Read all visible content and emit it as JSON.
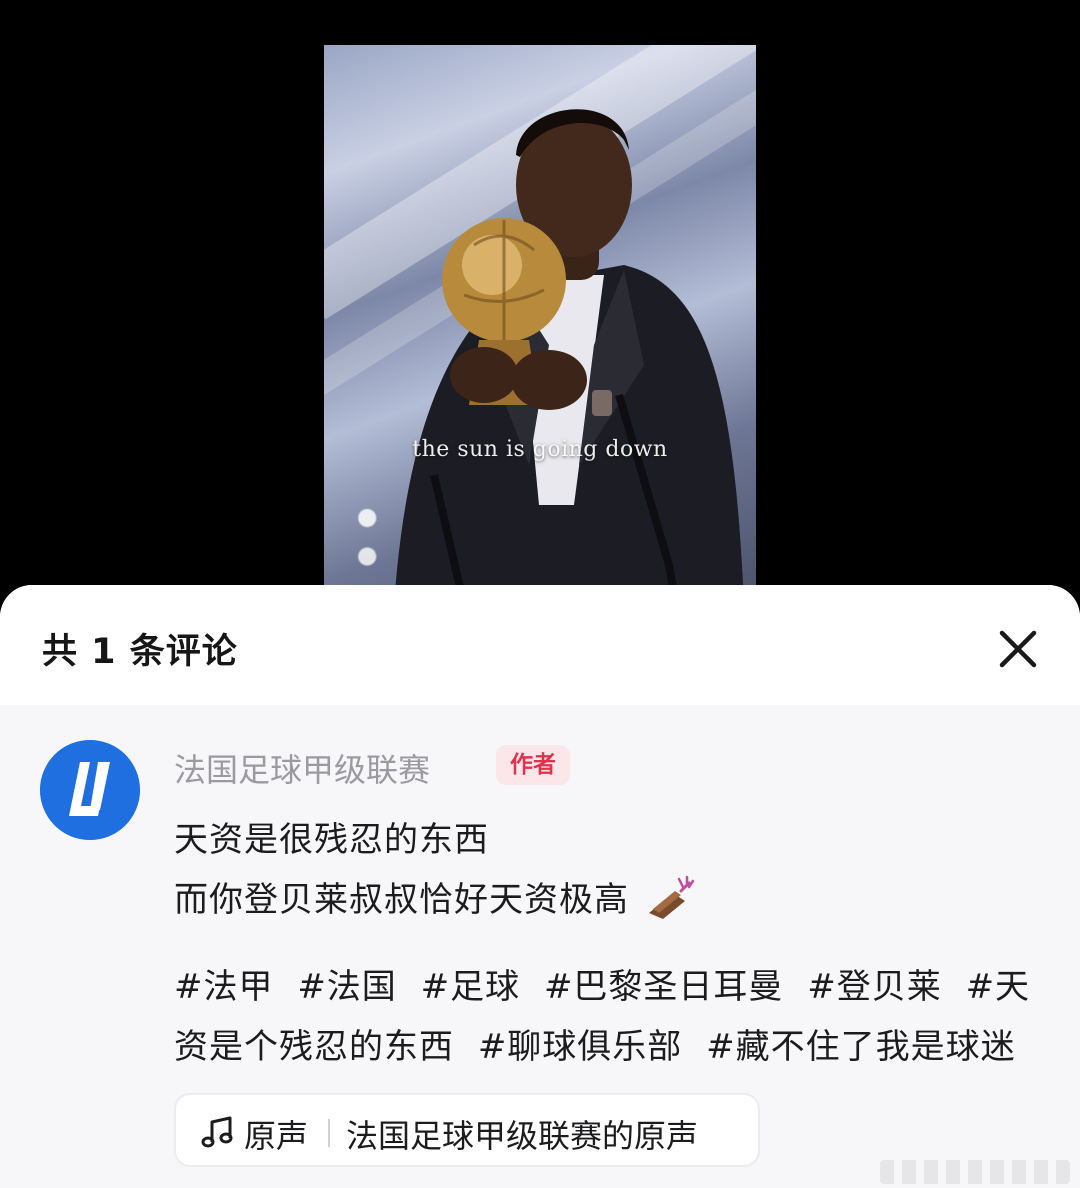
{
  "video": {
    "caption": "the sun is going down"
  },
  "comments_panel": {
    "title": "共 1 条评论",
    "close_icon": "close-icon"
  },
  "comment": {
    "author": "法国足球甲级联赛",
    "author_badge": "作者",
    "avatar_icon": "ligue1-logo",
    "lines": [
      "天资是很残忍的东西",
      "而你登贝莱叔叔恰好天资极高"
    ],
    "emoji_icon": "hand-clapping-emoji",
    "hashtags": [
      "#法甲",
      "#法国",
      "#足球",
      "#巴黎圣日耳曼",
      "#登贝莱",
      "#天资是个残忍的东西",
      "#聊球俱乐部",
      "#藏不住了我是球迷"
    ]
  },
  "music": {
    "icon": "music-note-icon",
    "label": "原声",
    "source": "法国足球甲级联赛的原声"
  },
  "colors": {
    "badge_bg": "#fbe7ea",
    "badge_text": "#e0324f",
    "avatar_bg": "#1f6fe0",
    "author_name": "#9a9aa0"
  }
}
